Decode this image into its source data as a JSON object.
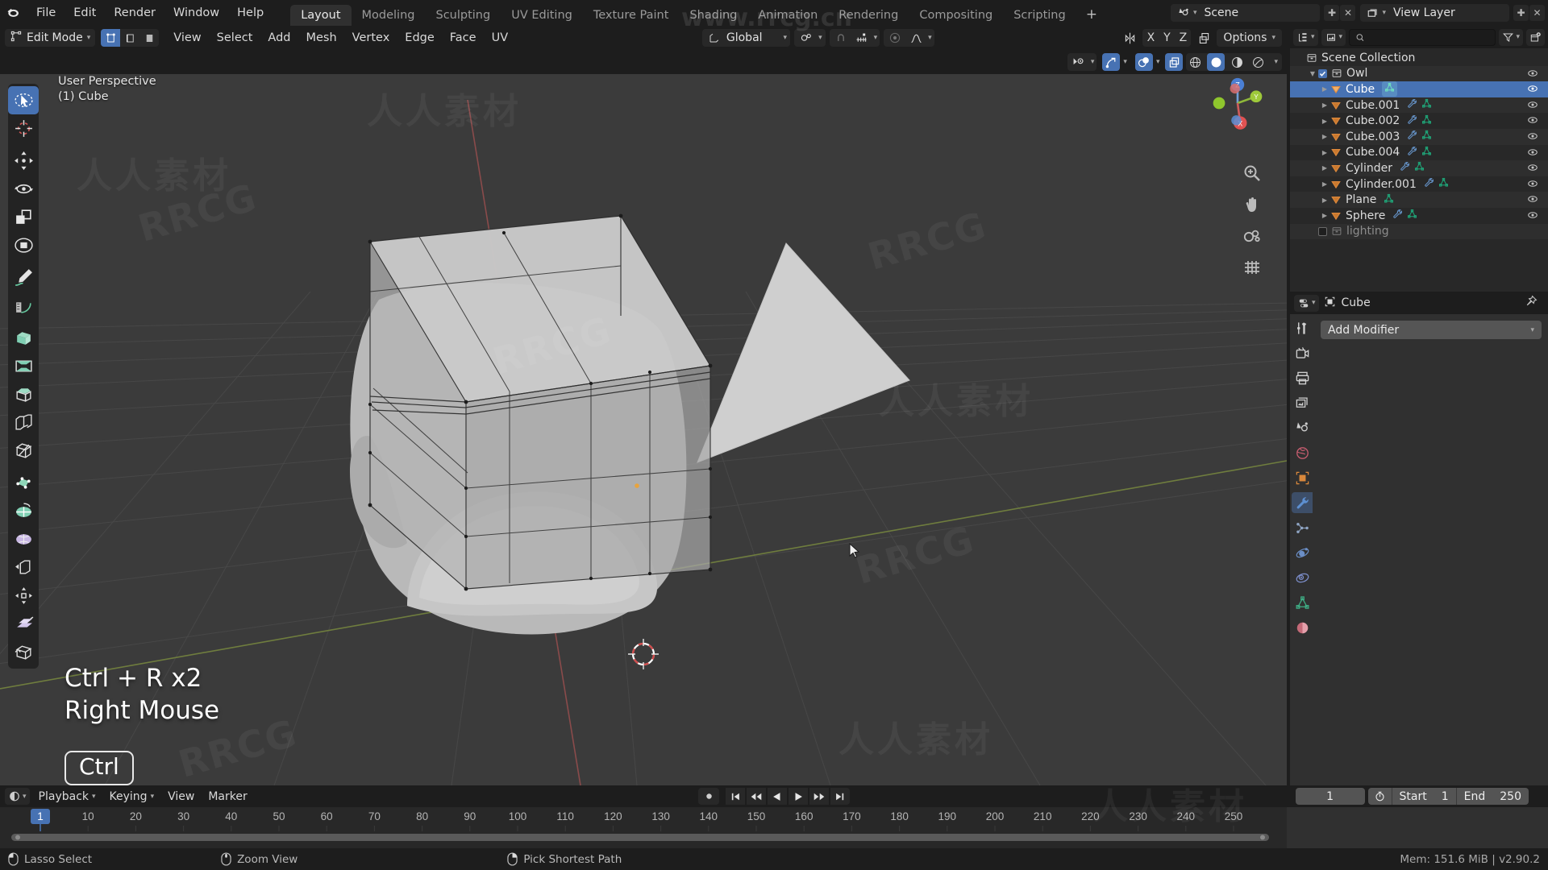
{
  "app": {
    "title": "Blender",
    "version_status": "Mem: 151.6 MiB | v2.90.2"
  },
  "topbar": {
    "logo_icon": "blender-logo-icon",
    "menus": [
      "File",
      "Edit",
      "Render",
      "Window",
      "Help"
    ],
    "workspace_tabs": [
      {
        "label": "Layout",
        "active": true
      },
      {
        "label": "Modeling",
        "active": false
      },
      {
        "label": "Sculpting",
        "active": false
      },
      {
        "label": "UV Editing",
        "active": false
      },
      {
        "label": "Texture Paint",
        "active": false
      },
      {
        "label": "Shading",
        "active": false
      },
      {
        "label": "Animation",
        "active": false
      },
      {
        "label": "Rendering",
        "active": false
      },
      {
        "label": "Compositing",
        "active": false
      },
      {
        "label": "Scripting",
        "active": false
      }
    ],
    "add_workspace_label": "+",
    "scene_name": "Scene",
    "view_layer_name": "View Layer",
    "scene_icon": "scene-icon",
    "viewlayer_icon": "view-layer-icon",
    "new_scene_icon": "new-scene-icon",
    "remove_scene_icon": "remove-scene-icon",
    "new_viewlayer_icon": "new-view-layer-icon",
    "remove_viewlayer_icon": "remove-view-layer-icon"
  },
  "viewport_header": {
    "mode": "Edit Mode",
    "mode_icon": "edit-mode-icon",
    "select_modes": [
      {
        "name": "vertex-select-mode",
        "active": true
      },
      {
        "name": "edge-select-mode",
        "active": false
      },
      {
        "name": "face-select-mode",
        "active": false
      }
    ],
    "menus": [
      "View",
      "Select",
      "Add",
      "Mesh",
      "Vertex",
      "Edge",
      "Face",
      "UV"
    ],
    "transform_orientation": "Global",
    "transform_orientation_icon": "orientation-gizmo-icon",
    "pivot_icon": "pivot-point-icon",
    "snap_magnet_icon": "snap-magnet-icon",
    "snap_target_icon": "snap-increment-icon",
    "proportional_edit_icon": "proportional-editing-icon",
    "proportional_falloff_icon": "falloff-curve-icon",
    "mirror_icon": "mirror-options-icon",
    "axis_labels": [
      "X",
      "Y",
      "Z"
    ],
    "xray_icon": "toggle-xray-icon",
    "options_label": "Options"
  },
  "viewport_overlay_header": {
    "visibility_icon": "object-visibility-icon",
    "gizmo_icon": "show-gizmo-icon",
    "overlays_icon": "show-overlays-icon",
    "xray_toggle_icon": "toggle-xray-icon",
    "shading_modes": [
      {
        "name": "wireframe-shading",
        "active": false
      },
      {
        "name": "solid-shading",
        "active": true
      },
      {
        "name": "material-preview-shading",
        "active": false
      },
      {
        "name": "rendered-shading",
        "active": false
      }
    ]
  },
  "viewport": {
    "perspective_label": "User Perspective",
    "object_label": "(1) Cube",
    "annotation_line1": "Ctrl + R x2",
    "annotation_line2": "Right Mouse",
    "keycap": "Ctrl",
    "gizmo_axes": [
      "X",
      "Y",
      "Z"
    ],
    "nav_buttons": [
      "zoom-view-icon",
      "pan-view-icon",
      "camera-view-icon",
      "toggle-perspective-icon"
    ],
    "tools": [
      {
        "name": "tweak-select-tool",
        "label": "Tweak / Select Box",
        "active": true
      },
      {
        "name": "cursor-tool",
        "label": "Cursor",
        "active": false
      },
      {
        "name": "move-tool",
        "label": "Move",
        "active": false
      },
      {
        "name": "rotate-tool",
        "label": "Rotate",
        "active": false
      },
      {
        "name": "scale-tool",
        "label": "Scale",
        "active": false
      },
      {
        "name": "transform-tool",
        "label": "Transform",
        "active": false
      },
      {
        "name": "annotate-tool",
        "label": "Annotate",
        "active": false
      },
      {
        "name": "measure-tool",
        "label": "Measure",
        "active": false
      },
      {
        "name": "extrude-region-tool",
        "label": "Extrude Region",
        "active": false
      },
      {
        "name": "inset-faces-tool",
        "label": "Inset Faces",
        "active": false
      },
      {
        "name": "bevel-tool",
        "label": "Bevel",
        "active": false
      },
      {
        "name": "loop-cut-tool",
        "label": "Loop Cut",
        "active": false
      },
      {
        "name": "knife-tool",
        "label": "Knife",
        "active": false
      },
      {
        "name": "poly-build-tool",
        "label": "Poly Build",
        "active": false
      },
      {
        "name": "spin-tool",
        "label": "Spin",
        "active": false
      },
      {
        "name": "smooth-tool",
        "label": "Smooth",
        "active": false
      },
      {
        "name": "edge-slide-tool",
        "label": "Edge Slide",
        "active": false
      },
      {
        "name": "shrink-fatten-tool",
        "label": "Shrink/Fatten",
        "active": false
      },
      {
        "name": "shear-tool",
        "label": "Shear",
        "active": false
      },
      {
        "name": "rip-region-tool",
        "label": "Rip Region",
        "active": false
      }
    ]
  },
  "outliner": {
    "display_mode_icon": "outliner-display-mode-icon",
    "filter_id_icon": "filter-id-type-icon",
    "search_icon": "search-icon",
    "search_value": "",
    "search_placeholder": "",
    "filter_icon": "filter-funnel-icon",
    "new_collection_icon": "new-collection-icon",
    "root": "Scene Collection",
    "rows": [
      {
        "label": "Scene Collection",
        "depth": 0,
        "type": "scene-collection",
        "icon": "collection-icon",
        "has_triangle": false,
        "has_checkbox": false,
        "selected": false,
        "dim": false,
        "modifier_icon": false,
        "mesh_icon": false,
        "eye": false
      },
      {
        "label": "Owl",
        "depth": 1,
        "type": "collection",
        "icon": "collection-icon",
        "has_triangle": true,
        "triangle": "down",
        "has_checkbox": true,
        "checked": true,
        "selected": false,
        "dim": false,
        "modifier_icon": false,
        "mesh_icon": false,
        "eye": true
      },
      {
        "label": "Cube",
        "depth": 2,
        "type": "object",
        "icon": "mesh-object-icon",
        "has_triangle": true,
        "triangle": "right",
        "has_checkbox": false,
        "selected": true,
        "dim": false,
        "modifier_icon": false,
        "mesh_icon": true,
        "eye": true
      },
      {
        "label": "Cube.001",
        "depth": 2,
        "type": "object",
        "icon": "mesh-object-icon",
        "has_triangle": true,
        "triangle": "right",
        "has_checkbox": false,
        "selected": false,
        "dim": false,
        "modifier_icon": true,
        "mesh_icon": true,
        "eye": true
      },
      {
        "label": "Cube.002",
        "depth": 2,
        "type": "object",
        "icon": "mesh-object-icon",
        "has_triangle": true,
        "triangle": "right",
        "has_checkbox": false,
        "selected": false,
        "dim": false,
        "modifier_icon": true,
        "mesh_icon": true,
        "eye": true
      },
      {
        "label": "Cube.003",
        "depth": 2,
        "type": "object",
        "icon": "mesh-object-icon",
        "has_triangle": true,
        "triangle": "right",
        "has_checkbox": false,
        "selected": false,
        "dim": false,
        "modifier_icon": true,
        "mesh_icon": true,
        "eye": true
      },
      {
        "label": "Cube.004",
        "depth": 2,
        "type": "object",
        "icon": "mesh-object-icon",
        "has_triangle": true,
        "triangle": "right",
        "has_checkbox": false,
        "selected": false,
        "dim": false,
        "modifier_icon": true,
        "mesh_icon": true,
        "eye": true
      },
      {
        "label": "Cylinder",
        "depth": 2,
        "type": "object",
        "icon": "mesh-object-icon",
        "has_triangle": true,
        "triangle": "right",
        "has_checkbox": false,
        "selected": false,
        "dim": false,
        "modifier_icon": true,
        "mesh_icon": true,
        "eye": true
      },
      {
        "label": "Cylinder.001",
        "depth": 2,
        "type": "object",
        "icon": "mesh-object-icon",
        "has_triangle": true,
        "triangle": "right",
        "has_checkbox": false,
        "selected": false,
        "dim": false,
        "modifier_icon": true,
        "mesh_icon": true,
        "eye": true
      },
      {
        "label": "Plane",
        "depth": 2,
        "type": "object",
        "icon": "mesh-object-icon",
        "has_triangle": true,
        "triangle": "right",
        "has_checkbox": false,
        "selected": false,
        "dim": false,
        "modifier_icon": false,
        "mesh_icon": true,
        "eye": true
      },
      {
        "label": "Sphere",
        "depth": 2,
        "type": "object",
        "icon": "mesh-object-icon",
        "has_triangle": true,
        "triangle": "right",
        "has_checkbox": false,
        "selected": false,
        "dim": false,
        "modifier_icon": true,
        "mesh_icon": true,
        "eye": true
      },
      {
        "label": "lighting",
        "depth": 1,
        "type": "collection",
        "icon": "collection-icon",
        "has_triangle": false,
        "has_checkbox": true,
        "checked": false,
        "selected": false,
        "dim": true,
        "modifier_icon": false,
        "mesh_icon": false,
        "eye": false
      }
    ]
  },
  "properties": {
    "editor_icon": "properties-editor-icon",
    "breadcrumb_icon": "object-icon",
    "breadcrumb": "Cube",
    "pin_icon": "pin-icon",
    "add_modifier_label": "Add Modifier",
    "tabs": [
      {
        "name": "tool-properties-tab",
        "icon": "tool-icon",
        "active": false
      },
      {
        "name": "render-properties-tab",
        "icon": "camera-back-icon",
        "active": false
      },
      {
        "name": "output-properties-tab",
        "icon": "printer-icon",
        "active": false
      },
      {
        "name": "view-layer-properties-tab",
        "icon": "images-icon",
        "active": false
      },
      {
        "name": "scene-properties-tab",
        "icon": "scene-icon",
        "active": false
      },
      {
        "name": "world-properties-tab",
        "icon": "world-globe-icon",
        "active": false
      },
      {
        "name": "object-properties-tab",
        "icon": "object-square-icon",
        "active": false
      },
      {
        "name": "modifier-properties-tab",
        "icon": "wrench-icon",
        "active": true
      },
      {
        "name": "particle-properties-tab",
        "icon": "particles-icon",
        "active": false
      },
      {
        "name": "physics-properties-tab",
        "icon": "physics-orbit-icon",
        "active": false
      },
      {
        "name": "constraint-properties-tab",
        "icon": "constraint-icon",
        "active": false
      },
      {
        "name": "data-properties-tab",
        "icon": "mesh-data-icon",
        "active": false
      },
      {
        "name": "material-properties-tab",
        "icon": "material-sphere-icon",
        "active": false
      }
    ]
  },
  "timeline": {
    "editor_icon": "timeline-editor-icon",
    "menus": [
      "Playback",
      "Keying",
      "View",
      "Marker"
    ],
    "menus_with_caret": [
      "Playback",
      "Keying"
    ],
    "record_icon": "auto-keying-record-icon",
    "transport": [
      {
        "name": "jump-to-start-button",
        "icon": "jump-start-icon"
      },
      {
        "name": "jump-to-prev-keyframe-button",
        "icon": "prev-keyframe-icon"
      },
      {
        "name": "play-reverse-button",
        "icon": "play-reverse-icon"
      },
      {
        "name": "play-button",
        "icon": "play-icon"
      },
      {
        "name": "jump-to-next-keyframe-button",
        "icon": "next-keyframe-icon"
      },
      {
        "name": "jump-to-end-button",
        "icon": "jump-end-icon"
      }
    ],
    "current_frame": "1",
    "timer_icon": "use-preview-range-icon",
    "start_label": "Start",
    "start_value": "1",
    "end_label": "End",
    "end_value": "250",
    "playhead_frame": "1",
    "ruler_ticks": [
      "10",
      "20",
      "30",
      "40",
      "50",
      "60",
      "70",
      "80",
      "90",
      "100",
      "110",
      "120",
      "130",
      "140",
      "150",
      "160",
      "170",
      "180",
      "190",
      "200",
      "210",
      "220",
      "230",
      "240",
      "250"
    ]
  },
  "statusbar": {
    "items": [
      {
        "icon": "mouse-left-drag-icon",
        "label": "Lasso Select"
      },
      {
        "icon": "mouse-middle-icon",
        "label": "Zoom View"
      },
      {
        "icon": "mouse-right-icon",
        "label": "Pick Shortest Path"
      }
    ],
    "right_text": "Mem: 151.6 MiB | v2.90.2"
  },
  "watermarks": {
    "url": "www.rrcg.cn",
    "brand": "RRCG",
    "cn_text": "人人素材",
    "footer_text": "人人素材"
  },
  "colors": {
    "accent_blue": "#4772b3",
    "viewport_bg": "#3b3b3b",
    "panel_bg": "#303030",
    "header_bg": "#1d1d1d",
    "outliner_bg": "#282828",
    "mesh_orange": "#e08a3c",
    "mesh_green": "#1fa87a",
    "modifier_blue": "#6694c9",
    "axis_x": "#e05252",
    "axis_y": "#9ec93a",
    "axis_z": "#4a7fd4"
  }
}
